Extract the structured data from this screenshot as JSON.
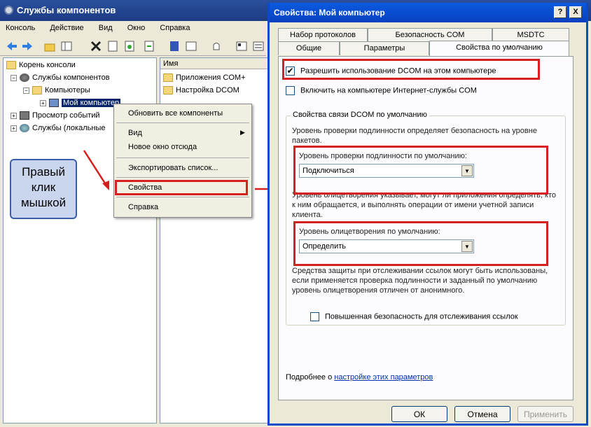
{
  "mmc": {
    "title": "Службы компонентов",
    "menu": [
      "Консоль",
      "Действие",
      "Вид",
      "Окно",
      "Справка"
    ],
    "tree": {
      "root": "Корень консоли",
      "component_services": "Службы компонентов",
      "computers": "Компьютеры",
      "my_computer": "Мой компьютер",
      "event_viewer": "Просмотр событий",
      "services": "Службы (локальные"
    },
    "list_header": "Имя",
    "list_items": [
      "Приложения COM+",
      "Настройка DCOM"
    ]
  },
  "context_menu": {
    "refresh": "Обновить все компоненты",
    "view": "Вид",
    "new_window": "Новое окно отсюда",
    "export": "Экспортировать список...",
    "properties": "Свойства",
    "help": "Справка"
  },
  "callout": {
    "line1": "Правый",
    "line2": "клик",
    "line3": "мышкой"
  },
  "dialog": {
    "title": "Свойства: Мой компьютер",
    "help_btn": "?",
    "close_btn": "X",
    "tabs_top": [
      "Набор протоколов",
      "Безопасность COM",
      "MSDTC"
    ],
    "tabs_bottom": [
      "Общие",
      "Параметры",
      "Свойства по умолчанию"
    ],
    "enable_dcom": "Разрешить использование DCOM на этом компьютере",
    "enable_internet": "Включить на компьютере Интернет-службы COM",
    "group_title": "Свойства связи DCOM по умолчанию",
    "auth_desc": "Уровень проверки подлинности определяет безопасность на уровне пакетов.",
    "auth_label": "Уровень проверки подлинности по умолчанию:",
    "auth_value": "Подключиться",
    "imp_desc": "Уровень олицетворения указывает, могут ли приложения определять, кто к ним обращается, и выполнять операции от имени учетной записи клиента.",
    "imp_label": "Уровень олицетворения по умолчанию:",
    "imp_value": "Определить",
    "tracking_desc": "Средства защиты при отслеживании ссылок могут быть использованы, если применяется проверка подлинности и заданный по умолчанию уровень олицетворения отличен от анонимного.",
    "extra_security": "Повышенная безопасность для отслеживания ссылок",
    "more_prefix": "Подробнее о ",
    "more_link": "настройке этих параметров",
    "ok": "ОК",
    "cancel": "Отмена",
    "apply": "Применить"
  },
  "colors": {
    "highlight": "#d62020",
    "titlebar": "#0a5ae0",
    "selection": "#0a246a"
  }
}
